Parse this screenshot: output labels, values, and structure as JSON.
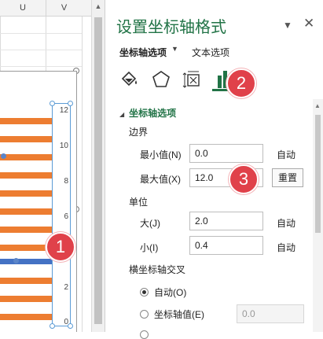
{
  "sheet": {
    "column_u": "U",
    "column_v": "V",
    "axis_ticks": [
      "12",
      "10",
      "8",
      "6",
      "4",
      "2",
      "0"
    ]
  },
  "pane": {
    "title": "设置坐标轴格式",
    "tabs": {
      "axis_options": "坐标轴选项",
      "text_options": "文本选项"
    },
    "section": "坐标轴选项",
    "bounds": {
      "label": "边界",
      "min_label": "最小值(N)",
      "min_value": "0.0",
      "min_status": "自动",
      "max_label": "最大值(X)",
      "max_value": "12.0",
      "max_status": "重置"
    },
    "units": {
      "label": "单位",
      "major_label": "大(J)",
      "major_value": "2.0",
      "major_status": "自动",
      "minor_label": "小(I)",
      "minor_value": "0.4",
      "minor_status": "自动"
    },
    "cross": {
      "label": "横坐标轴交叉",
      "auto": "自动(O)",
      "axis_value": "坐标轴值(E)",
      "axis_value_placeholder": "0.0"
    }
  },
  "badges": [
    "1",
    "2",
    "3"
  ],
  "colors": {
    "accent": "#217346",
    "orange_bar": "#ed7d31",
    "blue_bar": "#4472c4",
    "badge": "#e0414a"
  }
}
